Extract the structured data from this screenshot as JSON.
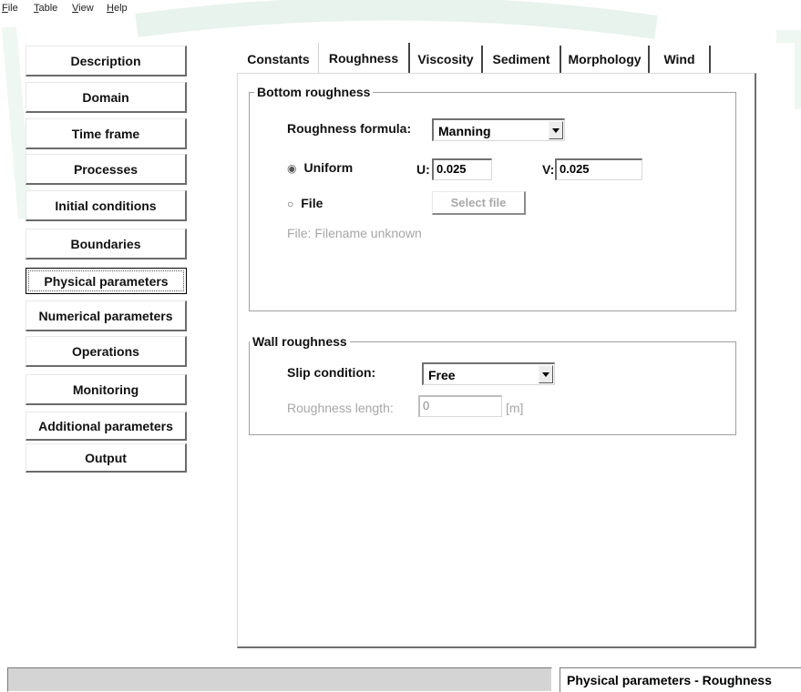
{
  "menu": [
    {
      "key": "F",
      "rest": "ile"
    },
    {
      "key": "T",
      "rest": "able"
    },
    {
      "key": "V",
      "rest": "iew"
    },
    {
      "key": "H",
      "rest": "elp"
    }
  ],
  "nav": {
    "description": "Description",
    "domain": "Domain",
    "time_frame": "Time frame",
    "processes": "Processes",
    "initial_conditions": "Initial conditions",
    "boundaries": "Boundaries",
    "physical_parameters": "Physical parameters",
    "numerical_parameters": "Numerical parameters",
    "operations": "Operations",
    "monitoring": "Monitoring",
    "additional_parameters": "Additional parameters",
    "output": "Output",
    "active": "Physical parameters"
  },
  "tabs": {
    "constants": "Constants",
    "roughness": "Roughness",
    "viscosity": "Viscosity",
    "sediment": "Sediment",
    "morphology": "Morphology",
    "wind": "Wind",
    "active": "Roughness"
  },
  "bottom_roughness": {
    "title": "Bottom roughness",
    "formula_label": "Roughness formula:",
    "formula_value": "Manning",
    "uniform_label": "Uniform",
    "u_label": "U:",
    "u_value": "0.025",
    "v_label": "V:",
    "v_value": "0.025",
    "file_label": "File",
    "select_file_button": "Select file",
    "file_info": "File:  Filename unknown",
    "selected_option": "Uniform"
  },
  "wall_roughness": {
    "title": "Wall roughness",
    "slip_label": "Slip condition:",
    "slip_value": "Free",
    "length_label": "Roughness length:",
    "length_value": "0",
    "length_unit": "[m]"
  },
  "status": {
    "left": "",
    "right": "Physical parameters - Roughness"
  },
  "icons": {
    "dropdown": "chevron-down-icon",
    "radio_selected": "radio-selected-icon",
    "radio_unselected": "radio-unselected-icon"
  }
}
